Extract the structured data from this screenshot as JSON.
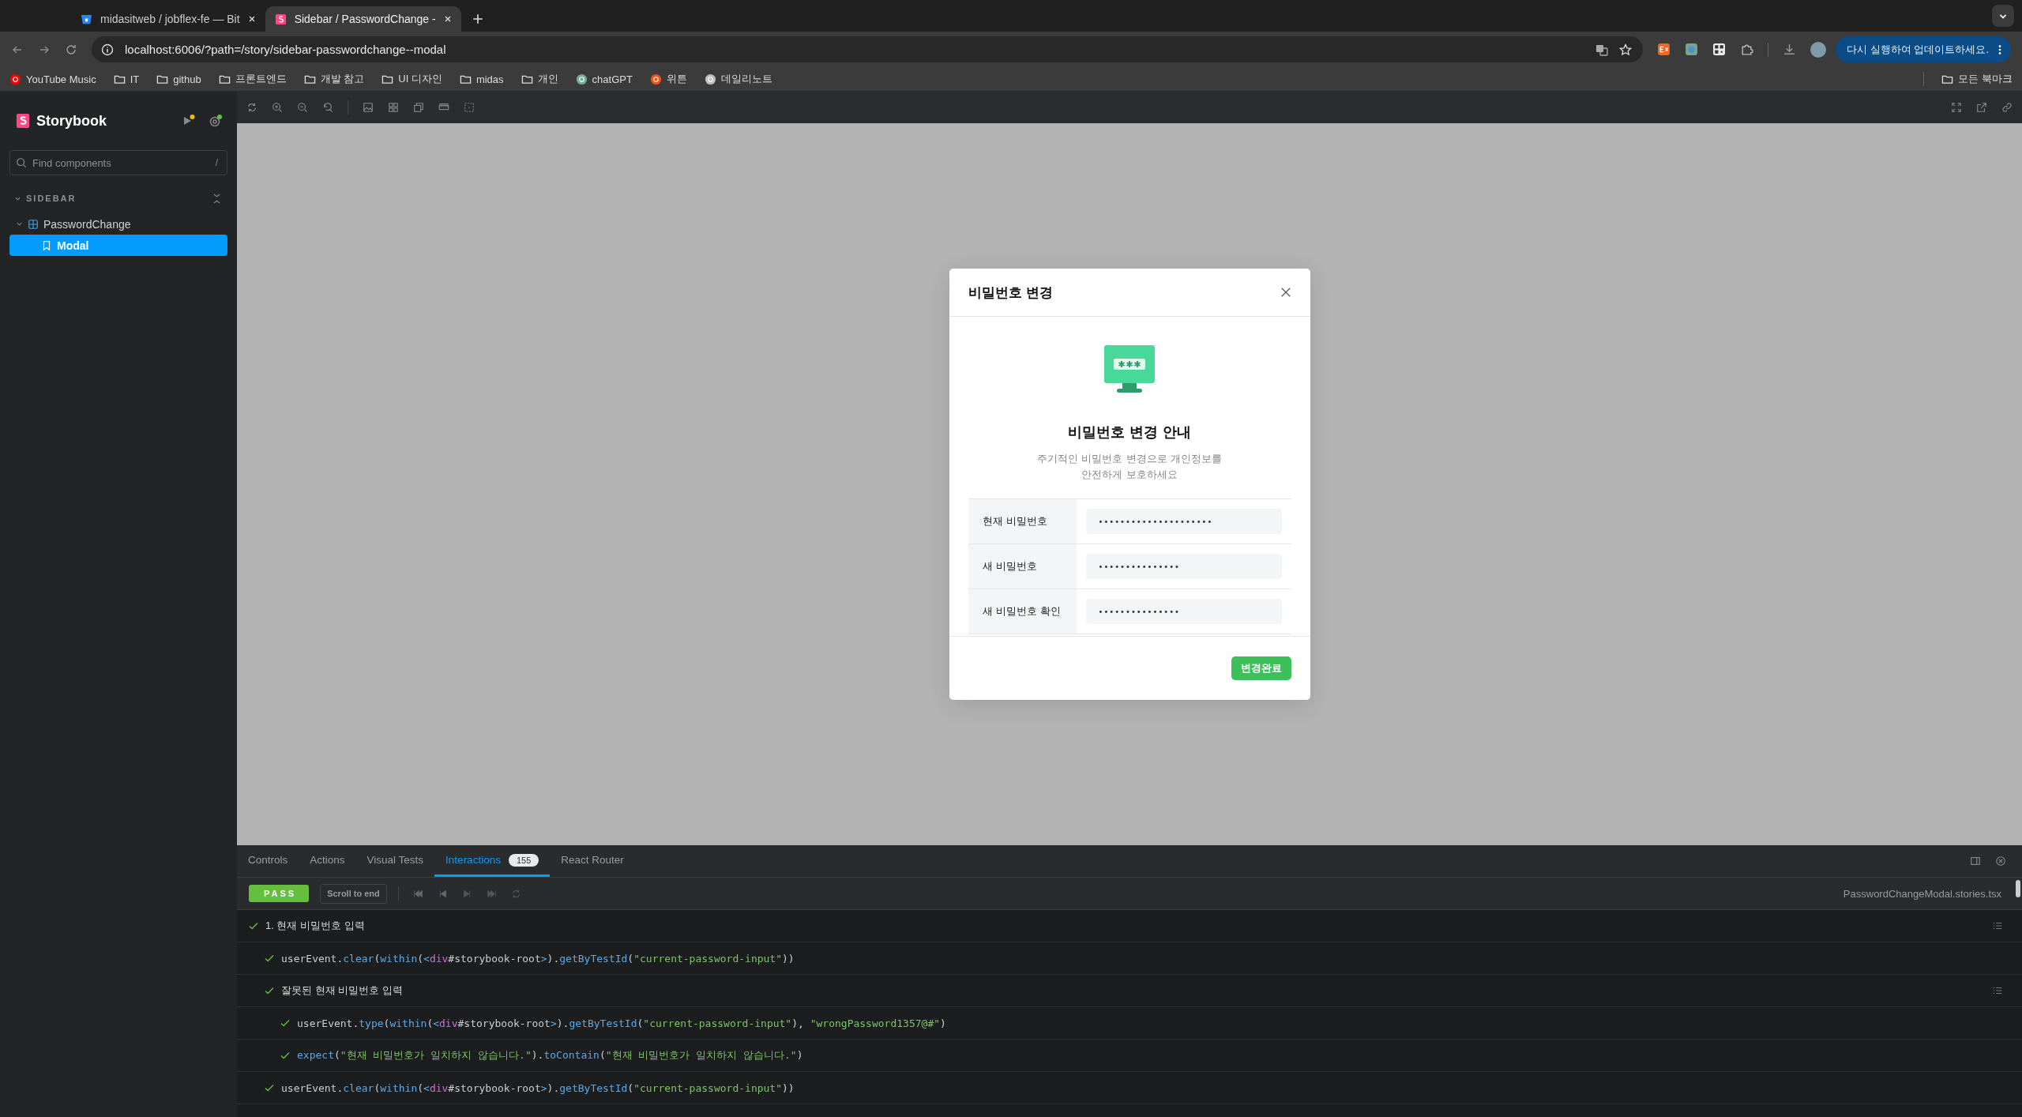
{
  "browser": {
    "tabs": [
      {
        "title": "midasitweb / jobflex-fe — Bit",
        "selected": false
      },
      {
        "title": "Sidebar / PasswordChange -",
        "selected": true
      }
    ],
    "address": "localhost:6006/?path=/story/sidebar-passwordchange--modal",
    "update_button": "다시 실행하여 업데이트하세요.",
    "bookmarks": [
      {
        "label": "YouTube Music",
        "kind": "site",
        "color": "#ff0000"
      },
      {
        "label": "IT",
        "kind": "folder"
      },
      {
        "label": "github",
        "kind": "folder"
      },
      {
        "label": "프론트엔드",
        "kind": "folder"
      },
      {
        "label": "개발 참고",
        "kind": "folder"
      },
      {
        "label": "UI 디자인",
        "kind": "folder"
      },
      {
        "label": "midas",
        "kind": "folder"
      },
      {
        "label": "개인",
        "kind": "folder"
      },
      {
        "label": "chatGPT",
        "kind": "site",
        "color": "#74aa9c"
      },
      {
        "label": "위튼",
        "kind": "site",
        "color": "#f0531c"
      },
      {
        "label": "데일리노트",
        "kind": "site",
        "color": "#bfbfbf"
      }
    ],
    "all_bookmarks": "모든 북마크"
  },
  "sidebar": {
    "brand": "Storybook",
    "search": {
      "placeholder": "Find components",
      "shortcut": "/"
    },
    "section": "SIDEBAR",
    "tree": [
      {
        "label": "PasswordChange",
        "kind": "component",
        "expanded": true,
        "selected": false,
        "children": [
          {
            "label": "Modal",
            "kind": "story",
            "selected": true
          }
        ]
      }
    ]
  },
  "modal": {
    "title": "비밀번호 변경",
    "heading": "비밀번호 변경 안내",
    "description": "주기적인 비밀번호 변경으로 개인정보를\n안전하게 보호하세요",
    "fields": [
      {
        "label": "현재 비밀번호",
        "value": "•••••••••••••••••••••"
      },
      {
        "label": "새 비밀번호",
        "value": "•••••••••••••••"
      },
      {
        "label": "새 비밀번호 확인",
        "value": "•••••••••••••••"
      }
    ],
    "submit": "변경완료"
  },
  "addons": {
    "tabs": [
      {
        "label": "Controls",
        "selected": false
      },
      {
        "label": "Actions",
        "selected": false
      },
      {
        "label": "Visual Tests",
        "selected": false
      },
      {
        "label": "Interactions",
        "selected": true,
        "badge": "155"
      },
      {
        "label": "React Router",
        "selected": false
      }
    ],
    "status": "PASS",
    "scroll_button": "Scroll to end",
    "file": "PasswordChangeModal.stories.tsx",
    "interactions": [
      {
        "kind": "step",
        "text": "1. 현재 비밀번호 입력",
        "children": [
          {
            "kind": "call",
            "tokens": [
              {
                "text": "userEvent.",
                "kind": "plain"
              },
              {
                "text": "clear",
                "kind": "fn"
              },
              {
                "text": "(",
                "kind": "plain"
              },
              {
                "text": "within",
                "kind": "fn"
              },
              {
                "text": "(",
                "kind": "plain"
              },
              {
                "text": "<",
                "kind": "fn"
              },
              {
                "text": "div",
                "kind": "tag"
              },
              {
                "text": "#storybook-root",
                "kind": "plain"
              },
              {
                "text": ">",
                "kind": "fn"
              },
              {
                "text": ").",
                "kind": "plain"
              },
              {
                "text": "getByTestId",
                "kind": "fn"
              },
              {
                "text": "(",
                "kind": "plain"
              },
              {
                "text": "\"current-password-input\"",
                "kind": "str"
              },
              {
                "text": "))",
                "kind": "plain"
              }
            ]
          },
          {
            "kind": "step",
            "text": "잘못된 현재 비밀번호 입력",
            "children": [
              {
                "kind": "call",
                "tokens": [
                  {
                    "text": "userEvent.",
                    "kind": "plain"
                  },
                  {
                    "text": "type",
                    "kind": "fn"
                  },
                  {
                    "text": "(",
                    "kind": "plain"
                  },
                  {
                    "text": "within",
                    "kind": "fn"
                  },
                  {
                    "text": "(",
                    "kind": "plain"
                  },
                  {
                    "text": "<",
                    "kind": "fn"
                  },
                  {
                    "text": "div",
                    "kind": "tag"
                  },
                  {
                    "text": "#storybook-root",
                    "kind": "plain"
                  },
                  {
                    "text": ">",
                    "kind": "fn"
                  },
                  {
                    "text": ").",
                    "kind": "plain"
                  },
                  {
                    "text": "getByTestId",
                    "kind": "fn"
                  },
                  {
                    "text": "(",
                    "kind": "plain"
                  },
                  {
                    "text": "\"current-password-input\"",
                    "kind": "str"
                  },
                  {
                    "text": "), ",
                    "kind": "plain"
                  },
                  {
                    "text": "\"wrongPassword1357@#\"",
                    "kind": "str"
                  },
                  {
                    "text": ")",
                    "kind": "plain"
                  }
                ]
              },
              {
                "kind": "call",
                "tokens": [
                  {
                    "text": "expect",
                    "kind": "fn"
                  },
                  {
                    "text": "(",
                    "kind": "plain"
                  },
                  {
                    "text": "\"현재 비밀번호가 일치하지 않습니다.\"",
                    "kind": "str"
                  },
                  {
                    "text": ").",
                    "kind": "plain"
                  },
                  {
                    "text": "toContain",
                    "kind": "fn"
                  },
                  {
                    "text": "(",
                    "kind": "plain"
                  },
                  {
                    "text": "\"현재 비밀번호가 일치하지 않습니다.\"",
                    "kind": "str"
                  },
                  {
                    "text": ")",
                    "kind": "plain"
                  }
                ]
              }
            ]
          },
          {
            "kind": "call",
            "tokens": [
              {
                "text": "userEvent.",
                "kind": "plain"
              },
              {
                "text": "clear",
                "kind": "fn"
              },
              {
                "text": "(",
                "kind": "plain"
              },
              {
                "text": "within",
                "kind": "fn"
              },
              {
                "text": "(",
                "kind": "plain"
              },
              {
                "text": "<",
                "kind": "fn"
              },
              {
                "text": "div",
                "kind": "tag"
              },
              {
                "text": "#storybook-root",
                "kind": "plain"
              },
              {
                "text": ">",
                "kind": "fn"
              },
              {
                "text": ").",
                "kind": "plain"
              },
              {
                "text": "getByTestId",
                "kind": "fn"
              },
              {
                "text": "(",
                "kind": "plain"
              },
              {
                "text": "\"current-password-input\"",
                "kind": "str"
              },
              {
                "text": "))",
                "kind": "plain"
              }
            ]
          }
        ]
      }
    ]
  }
}
